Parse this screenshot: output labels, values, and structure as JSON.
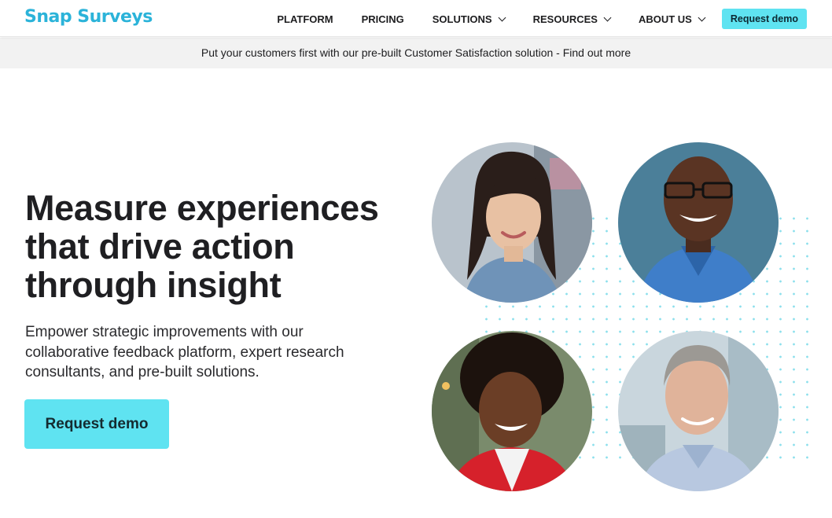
{
  "brand": {
    "logo_text": "Snap Surveys",
    "accent": "#5fe3f1",
    "logo_color": "#2bb3d9"
  },
  "nav": {
    "items": [
      {
        "label": "PLATFORM",
        "has_dropdown": false
      },
      {
        "label": "PRICING",
        "has_dropdown": false
      },
      {
        "label": "SOLUTIONS",
        "has_dropdown": true
      },
      {
        "label": "RESOURCES",
        "has_dropdown": true
      },
      {
        "label": "ABOUT US",
        "has_dropdown": true
      }
    ],
    "demo_label": "Request demo",
    "dropdown_icon": "chevron-down-icon"
  },
  "announcement": {
    "text": "Put your customers first with our pre-built Customer Satisfaction solution - Find out more"
  },
  "hero": {
    "headline_lines": [
      "Measure experiences",
      "that drive action",
      "through insight"
    ],
    "subtext_lines": [
      "Empower strategic improvements with our",
      "collaborative feedback platform, expert research",
      "consultants, and pre-built solutions."
    ],
    "cta_label": "Request demo"
  },
  "portraits": [
    {
      "name": "portrait-woman-long-dark-hair"
    },
    {
      "name": "portrait-man-glasses"
    },
    {
      "name": "portrait-woman-curly-hair"
    },
    {
      "name": "portrait-man-grey-hair"
    }
  ]
}
